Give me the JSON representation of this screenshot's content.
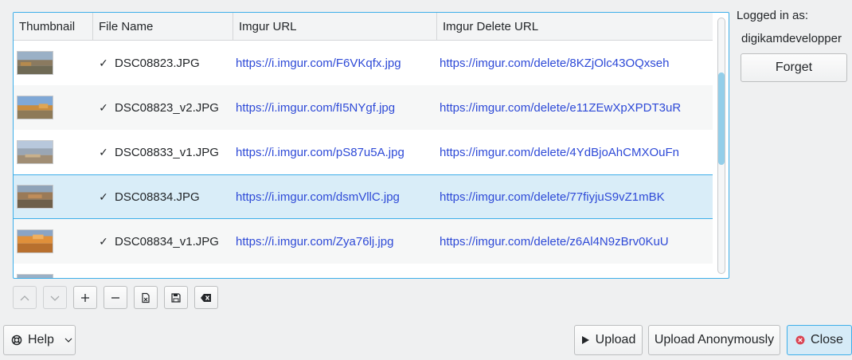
{
  "table": {
    "headers": [
      "Thumbnail",
      "File Name",
      "Imgur URL",
      "Imgur Delete URL"
    ],
    "rows": [
      {
        "file": "DSC08823.JPG",
        "status": "✓",
        "url": "https://i.imgur.com/F6VKqfx.jpg",
        "delete_url": "https://imgur.com/delete/8KZjOlc43OQxseh"
      },
      {
        "file": "DSC08823_v2.JPG",
        "status": "✓",
        "url": "https://i.imgur.com/fI5NYgf.jpg",
        "delete_url": "https://imgur.com/delete/e11ZEwXpXPDT3uR"
      },
      {
        "file": "DSC08833_v1.JPG",
        "status": "✓",
        "url": "https://i.imgur.com/pS87u5A.jpg",
        "delete_url": "https://imgur.com/delete/4YdBjoAhCMXOuFn"
      },
      {
        "file": "DSC08834.JPG",
        "status": "✓",
        "url": "https://i.imgur.com/dsmVllC.jpg",
        "delete_url": "https://imgur.com/delete/77fiyjuS9vZ1mBK"
      },
      {
        "file": "DSC08834_v1.JPG",
        "status": "✓",
        "url": "https://i.imgur.com/Zya76lj.jpg",
        "delete_url": "https://imgur.com/delete/z6Al4N9zBrv0KuU"
      }
    ],
    "selected_row": 3
  },
  "toolbar": {
    "icons": [
      "chevron-up-icon",
      "chevron-down-icon",
      "plus-icon",
      "minus-icon",
      "clear-list-icon",
      "save-icon",
      "clear-processed-icon"
    ]
  },
  "account": {
    "logged_in_label": "Logged in as:",
    "username": "digikamdevelopper",
    "forget_label": "Forget"
  },
  "footer": {
    "help_label": "Help",
    "upload_label": "Upload",
    "upload_anon_label": "Upload Anonymously",
    "close_label": "Close"
  },
  "colors": {
    "accent": "#3daee9",
    "link": "#2e4ad7",
    "selection": "#d9edf8",
    "close_icon": "#da4453"
  }
}
